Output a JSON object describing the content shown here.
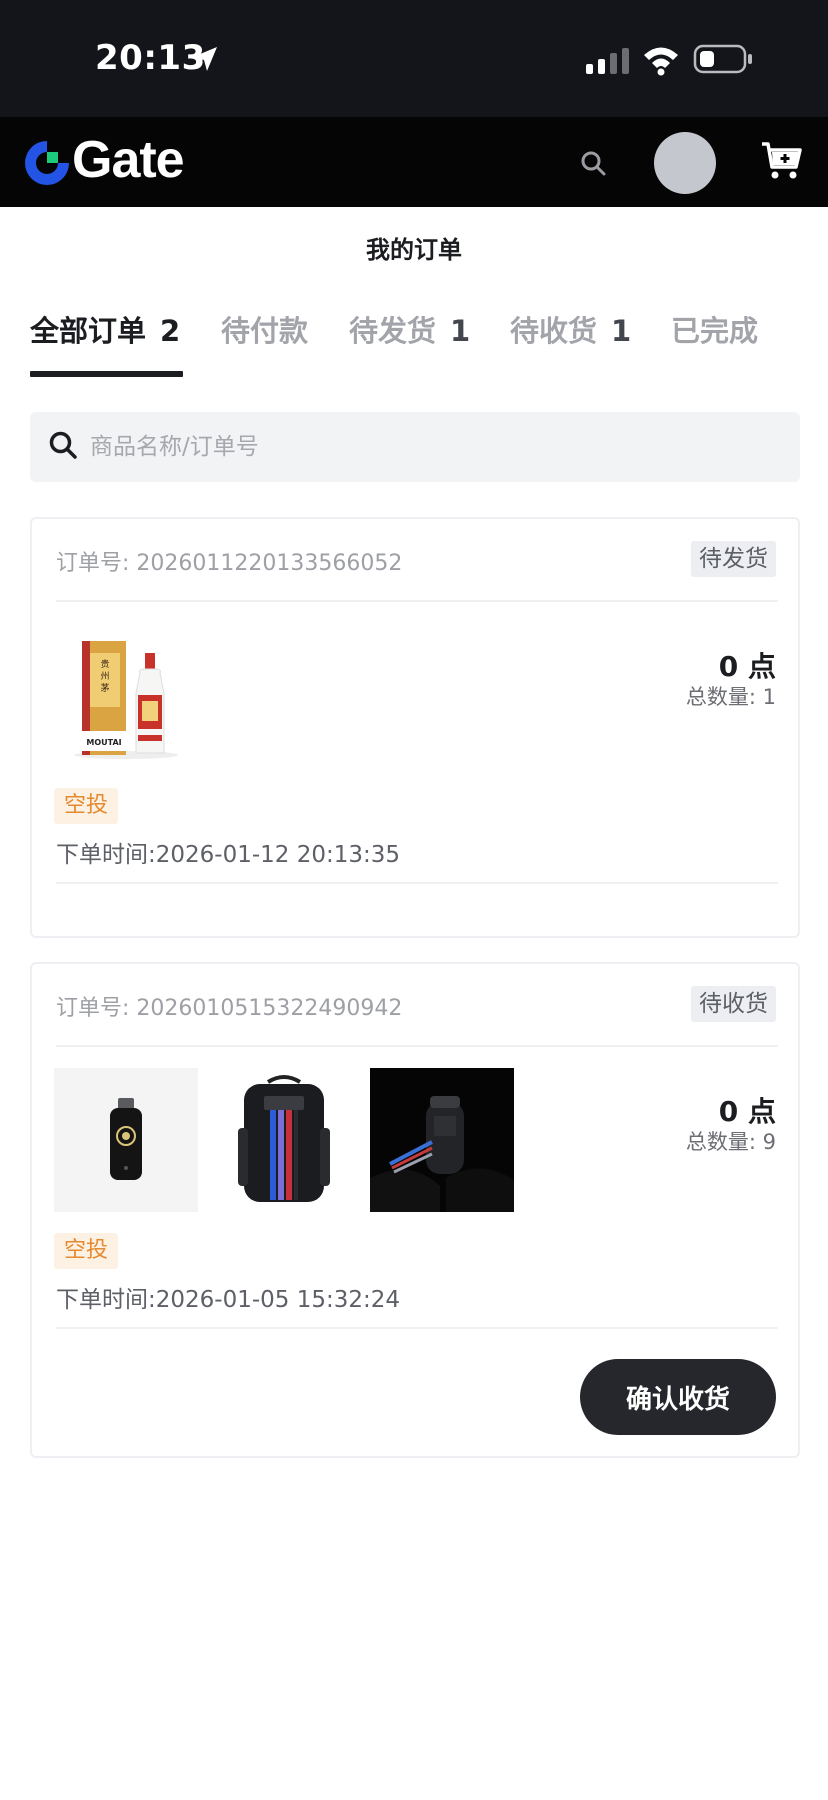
{
  "status_bar": {
    "time": "20:13"
  },
  "header": {
    "logo_text": "Gate",
    "brand_color": "#2354e6",
    "accent_color": "#1dc97a"
  },
  "page_title": "我的订单",
  "tabs": [
    {
      "label": "全部订单",
      "count": "2",
      "active": true
    },
    {
      "label": "待付款",
      "count": "",
      "active": false
    },
    {
      "label": "待发货",
      "count": "1",
      "active": false
    },
    {
      "label": "待收货",
      "count": "1",
      "active": false
    },
    {
      "label": "已完成",
      "count": "",
      "active": false
    }
  ],
  "search": {
    "placeholder": "商品名称/订单号",
    "value": ""
  },
  "orders": [
    {
      "order_no": "订单号: 2026011220133566052",
      "status": "待发货",
      "items": [
        "moutai-liquor-image"
      ],
      "price": "0 点",
      "qty": "总数量: 1",
      "tag": "空投",
      "time": "下单时间:2026-01-12 20:13:35"
    },
    {
      "order_no": "订单号: 2026010515322490942",
      "status": "待收货",
      "items": [
        "security-key-image",
        "backpack-image",
        "hand-warmer-image"
      ],
      "price": "0 点",
      "qty": "总数量: 9",
      "tag": "空投",
      "time": "下单时间:2026-01-05 15:32:24",
      "action": "确认收货"
    }
  ]
}
